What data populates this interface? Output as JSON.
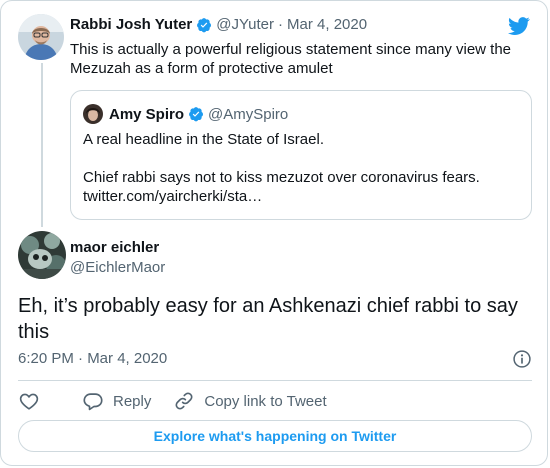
{
  "tweet1": {
    "name": "Rabbi Josh Yuter",
    "handle": "@JYuter",
    "separator": "·",
    "date": "Mar 4, 2020",
    "text": "This is actually a powerful religious statement since many view the Mezuzah as a form of protective amulet"
  },
  "quoted": {
    "name": "Amy Spiro",
    "handle": "@AmySpiro",
    "line1": "A real headline in the State of Israel.",
    "line2": "Chief rabbi says not to kiss mezuzot over coronavirus fears.",
    "line3": "twitter.com/yaircherki/sta…"
  },
  "tweet2": {
    "name": "maor eichler",
    "handle": "@EichlerMaor",
    "text": "Eh, it’s probably easy for an Ashkenazi chief rabbi to say this",
    "timestamp": "6:20 PM · Mar 4, 2020"
  },
  "actions": {
    "reply": "Reply",
    "copy_link": "Copy link to Tweet"
  },
  "explore_label": "Explore what's happening on Twitter",
  "colors": {
    "accent": "#1d9bf0",
    "muted": "#536471",
    "border": "#cfd9de",
    "text": "#0f1419"
  },
  "icons": [
    "twitter-bird-icon",
    "verified-badge-icon",
    "info-icon",
    "heart-icon",
    "reply-icon",
    "link-icon"
  ]
}
